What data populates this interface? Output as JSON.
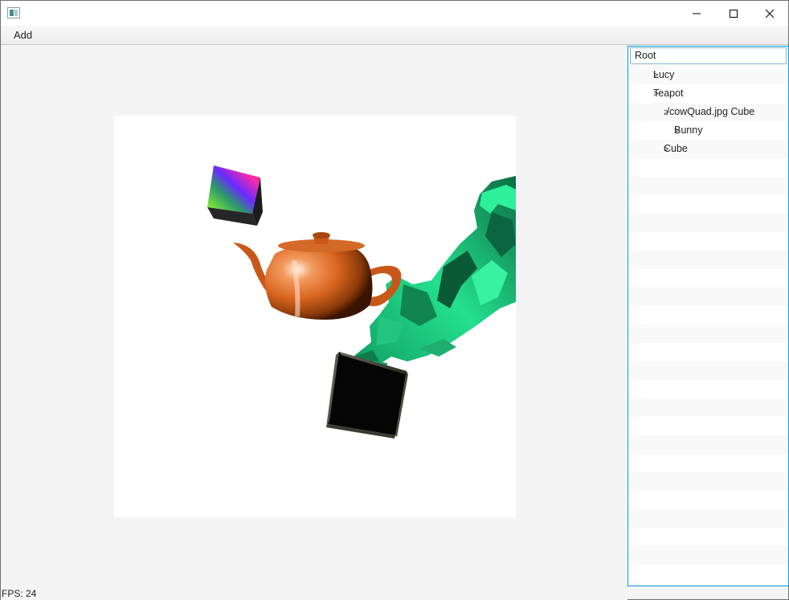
{
  "window": {
    "minimize_icon": "minimize-icon",
    "maximize_icon": "maximize-icon",
    "close_icon": "close-icon"
  },
  "menu": {
    "items": [
      {
        "label": "Add"
      }
    ]
  },
  "viewport": {
    "background": "#ffffff",
    "objects": [
      {
        "name": "Lucy",
        "color": "#1fd68a"
      },
      {
        "name": "Teapot",
        "color": "#e4702a"
      },
      {
        "name": "Cube",
        "color": "rainbow"
      },
      {
        "name": "Cube",
        "color": "#111111"
      }
    ]
  },
  "status": {
    "fps": "FPS: 24"
  },
  "scene_tree": {
    "accent": "#039ed3",
    "root": "Root",
    "items": [
      {
        "arrow": ">",
        "label": "Lucy"
      },
      {
        "arrow": ">",
        "label": "Teapot"
      },
      {
        "arrow": ">",
        "label": "./cowQuad.jpg Cube"
      },
      {
        "arrow": ">",
        "label": "Bunny"
      },
      {
        "arrow": ">",
        "label": "Cube"
      }
    ]
  }
}
